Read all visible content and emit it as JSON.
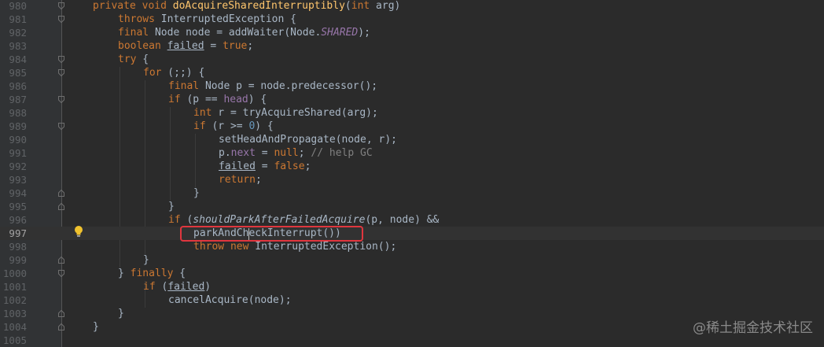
{
  "watermark": "@稀土掘金技术社区",
  "lines": [
    {
      "num": "980",
      "code": "private void doAcquireSharedInterruptibly(int arg)"
    },
    {
      "num": "981",
      "code": "throws InterruptedException {"
    },
    {
      "num": "982",
      "code": "final Node node = addWaiter(Node.SHARED);"
    },
    {
      "num": "983",
      "code": "boolean failed = true;"
    },
    {
      "num": "984",
      "code": "try {"
    },
    {
      "num": "985",
      "code": "for (;;) {"
    },
    {
      "num": "986",
      "code": "final Node p = node.predecessor();"
    },
    {
      "num": "987",
      "code": "if (p == head) {"
    },
    {
      "num": "988",
      "code": "int r = tryAcquireShared(arg);"
    },
    {
      "num": "989",
      "code": "if (r >= 0) {"
    },
    {
      "num": "990",
      "code": "setHeadAndPropagate(node, r);"
    },
    {
      "num": "991",
      "code": "p.next = null; // help GC"
    },
    {
      "num": "992",
      "code": "failed = false;"
    },
    {
      "num": "993",
      "code": "return;"
    },
    {
      "num": "994",
      "code": "}"
    },
    {
      "num": "995",
      "code": "}"
    },
    {
      "num": "996",
      "code": "if (shouldParkAfterFailedAcquire(p, node) &&"
    },
    {
      "num": "997",
      "code": "parkAndCheckInterrupt())"
    },
    {
      "num": "998",
      "code": "throw new InterruptedException();"
    },
    {
      "num": "999",
      "code": "}"
    },
    {
      "num": "1000",
      "code": "} finally {"
    },
    {
      "num": "1001",
      "code": "if (failed)"
    },
    {
      "num": "1002",
      "code": "cancelAcquire(node);"
    },
    {
      "num": "1003",
      "code": "}"
    },
    {
      "num": "1004",
      "code": "}"
    },
    {
      "num": "1005",
      "code": ""
    }
  ],
  "tokens": {
    "l980": [
      "private",
      "void",
      "doAcquireSharedInterruptibly",
      "(",
      "int",
      " arg)"
    ],
    "l981": [
      "throws",
      " InterruptedException {"
    ],
    "l982": [
      "final",
      " Node node = addWaiter(Node.",
      "SHARED",
      ");"
    ],
    "l983": [
      "boolean",
      " ",
      "failed",
      " = ",
      "true",
      ";"
    ],
    "l984": [
      "try",
      " {"
    ],
    "l985": [
      "for",
      " (;;) {"
    ],
    "l986": [
      "final",
      " Node p = node.predecessor();"
    ],
    "l987": [
      "if",
      " (p == ",
      "head",
      ") {"
    ],
    "l988": [
      "int",
      " r = tryAcquireShared(arg);"
    ],
    "l989": [
      "if",
      " (r >= ",
      "0",
      ") {"
    ],
    "l990": [
      "setHeadAndPropagate(node, r);"
    ],
    "l991": [
      "p.",
      "next",
      " = ",
      "null",
      "; ",
      "// help GC"
    ],
    "l992": [
      "failed",
      " = ",
      "false",
      ";"
    ],
    "l993": [
      "return",
      ";"
    ],
    "l994": [
      "}"
    ],
    "l995": [
      "}"
    ],
    "l996": [
      "if",
      " (",
      "shouldParkAfterFailedAcquire",
      "(p, node) &&"
    ],
    "l997": [
      "parkAndCheckInterrupt())"
    ],
    "l998": [
      "throw",
      " ",
      "new",
      " InterruptedException();"
    ],
    "l999": [
      "}"
    ],
    "l1000": [
      "} ",
      "finally",
      " {"
    ],
    "l1001": [
      "if",
      " (",
      "failed",
      ")"
    ],
    "l1002": [
      "cancelAcquire(node);"
    ],
    "l1003": [
      "}"
    ],
    "l1004": [
      "}"
    ]
  },
  "icons": {
    "intention": "lightbulb-icon",
    "fold": "fold-marker-icon"
  },
  "colors": {
    "highlight_box": "#e0363e",
    "keyword": "#cc7832",
    "method_decl": "#ffc66d",
    "field": "#9876aa",
    "number": "#6897bb",
    "comment": "#808080"
  }
}
